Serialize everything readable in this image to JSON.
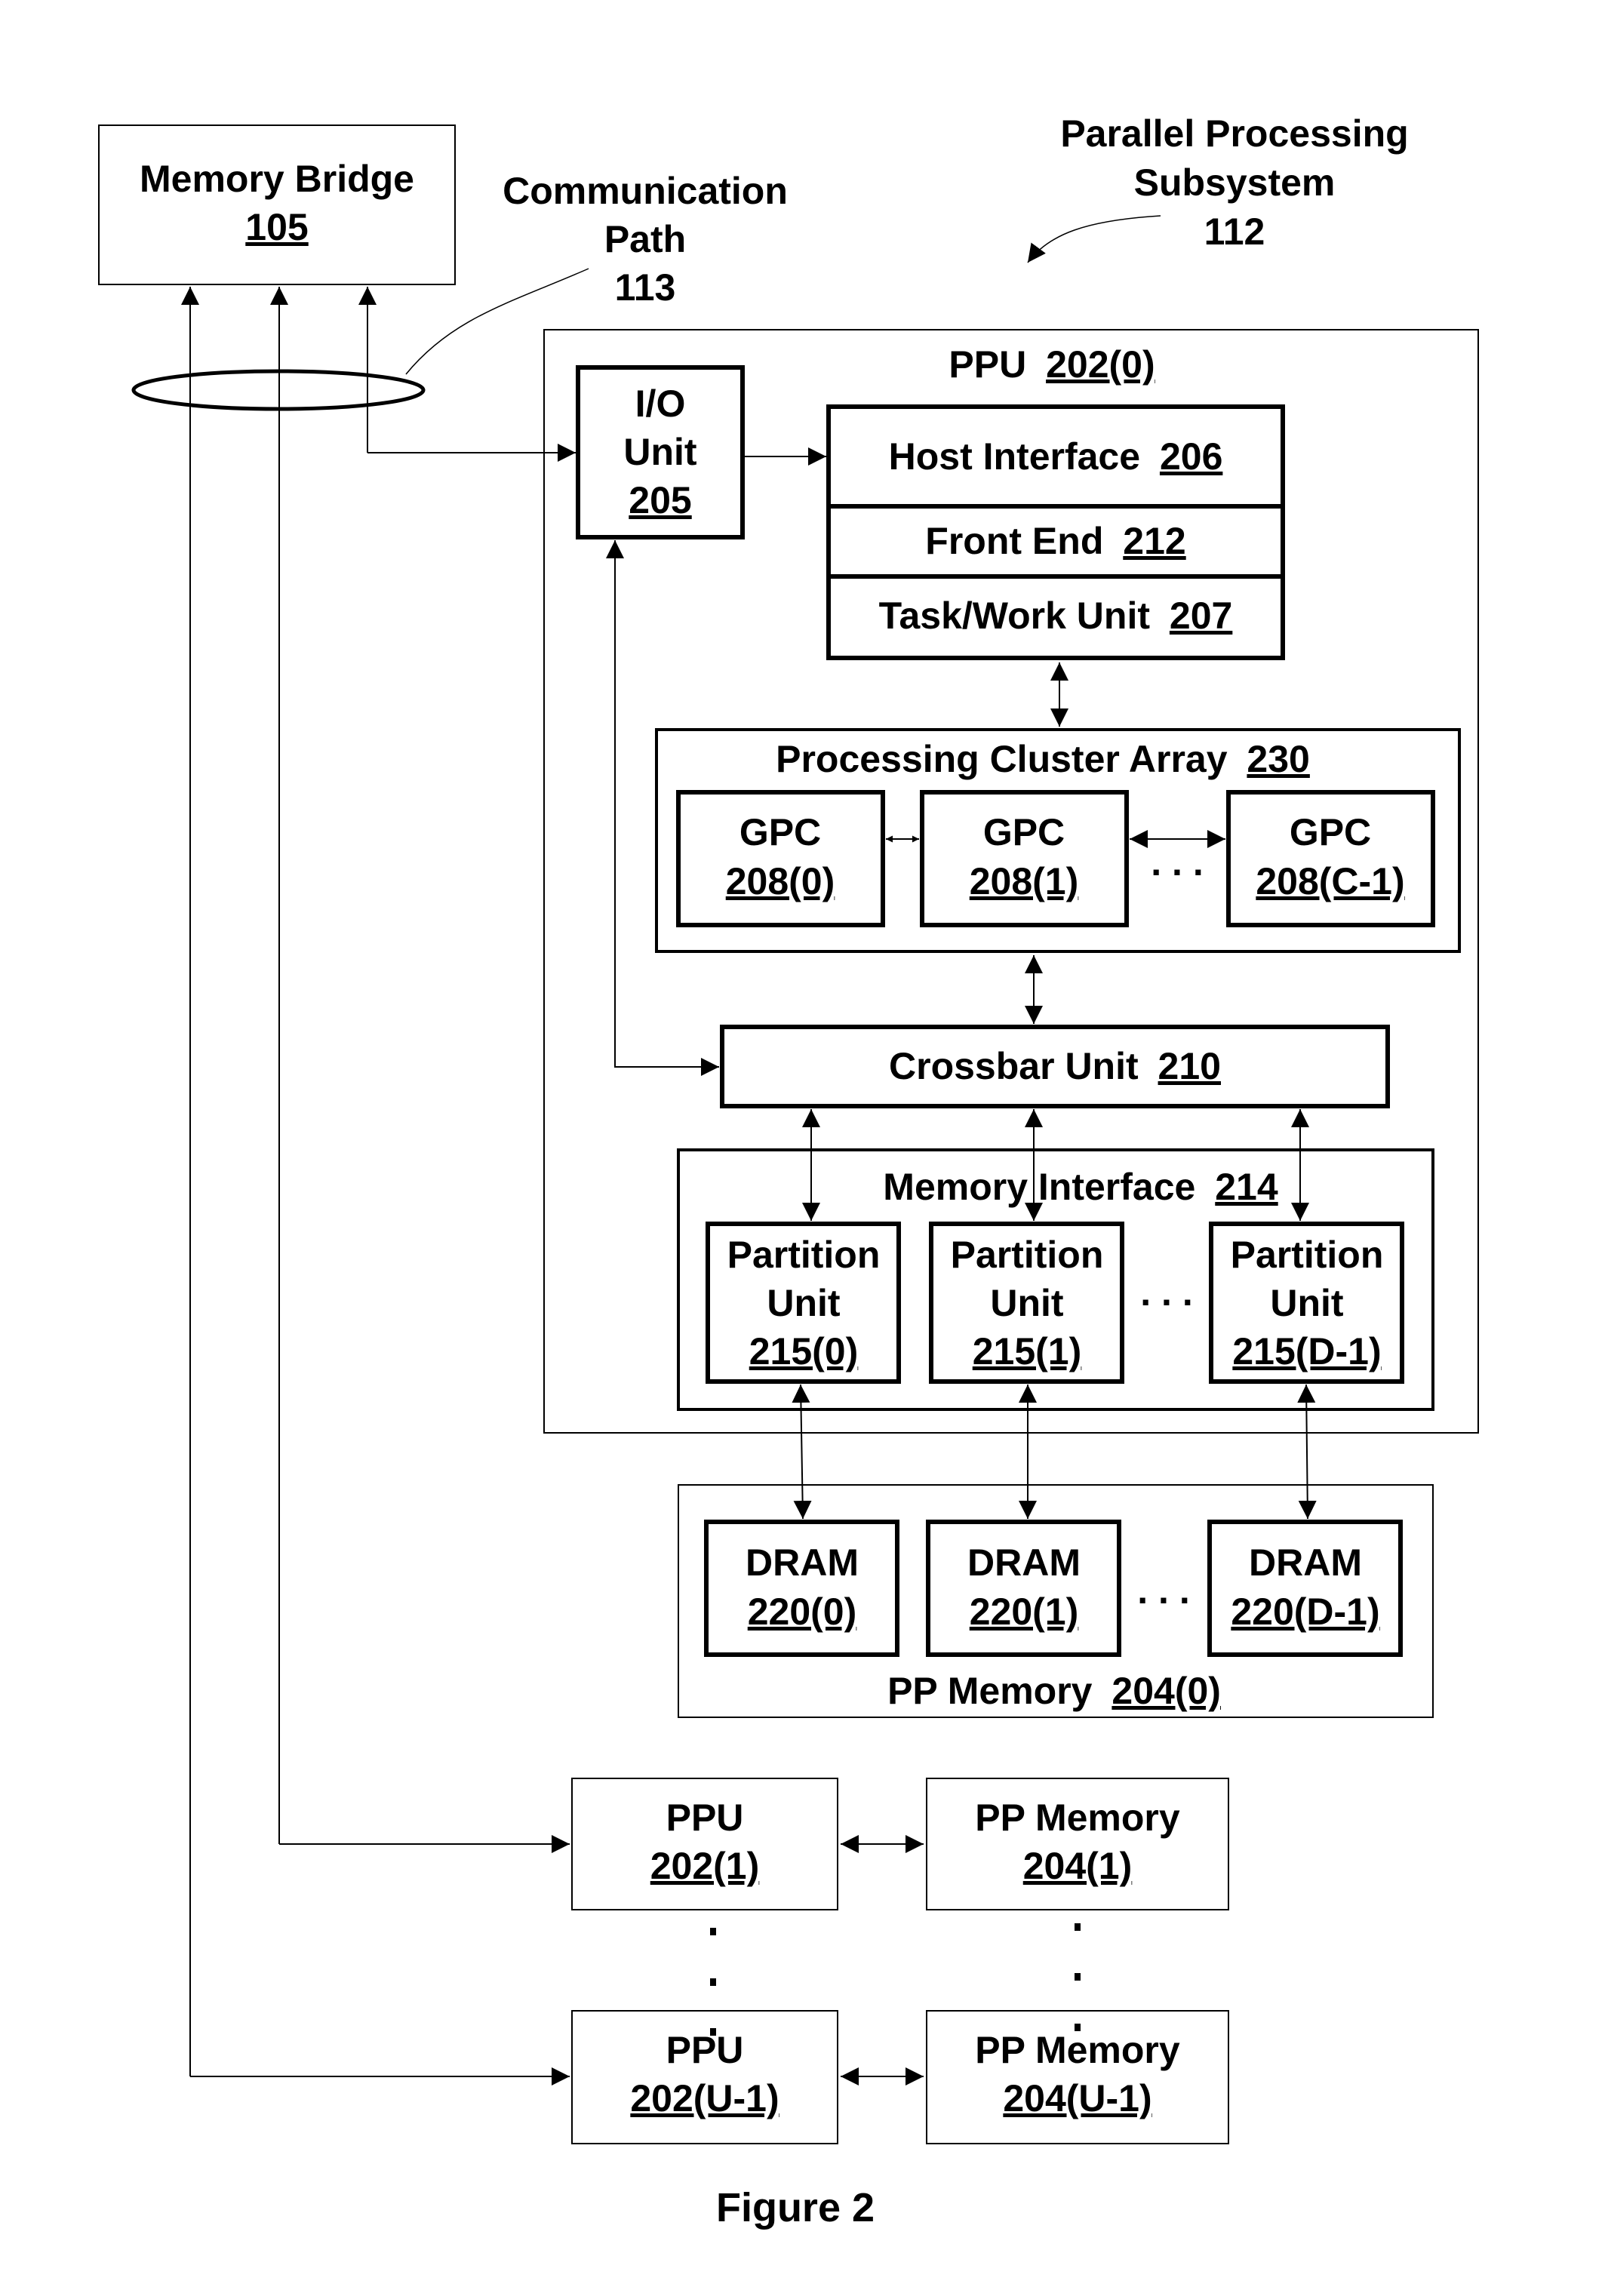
{
  "figure_caption": "Figure 2",
  "colors": {
    "line": "#000000",
    "background": "#ffffff"
  },
  "memory_bridge": {
    "name": "Memory Bridge",
    "ref": "105"
  },
  "communication_path": {
    "line1": "Communication",
    "line2": "Path",
    "ref": "113"
  },
  "subsystem": {
    "line1": "Parallel Processing",
    "line2": "Subsystem",
    "ref": "112"
  },
  "ppu0": {
    "name": "PPU",
    "ref": "202(0)",
    "io_unit": {
      "line1": "I/O",
      "line2": "Unit",
      "ref": "205"
    },
    "host_interface": {
      "name": "Host Interface",
      "ref": "206"
    },
    "front_end": {
      "name": "Front End",
      "ref": "212"
    },
    "task_work_unit": {
      "name": "Task/Work Unit",
      "ref": "207"
    },
    "processing_cluster_array": {
      "name": "Processing Cluster Array",
      "ref": "230",
      "gpcs": [
        {
          "name": "GPC",
          "ref": "208(0)"
        },
        {
          "name": "GPC",
          "ref": "208(1)"
        },
        {
          "name": "GPC",
          "ref": "208(C-1)"
        }
      ],
      "ellipsis": ". . ."
    },
    "crossbar": {
      "name": "Crossbar Unit",
      "ref": "210"
    },
    "memory_interface": {
      "name": "Memory Interface",
      "ref": "214",
      "partitions": [
        {
          "line1": "Partition",
          "line2": "Unit",
          "ref": "215(0)"
        },
        {
          "line1": "Partition",
          "line2": "Unit",
          "ref": "215(1)"
        },
        {
          "line1": "Partition",
          "line2": "Unit",
          "ref": "215(D-1)"
        }
      ],
      "ellipsis": ". . ."
    }
  },
  "pp_memory0": {
    "name": "PP Memory",
    "ref": "204(0)",
    "drams": [
      {
        "name": "DRAM",
        "ref": "220(0)"
      },
      {
        "name": "DRAM",
        "ref": "220(1)"
      },
      {
        "name": "DRAM",
        "ref": "220(D-1)"
      }
    ],
    "ellipsis": ". . ."
  },
  "additional_ppus": [
    {
      "ppu_name": "PPU",
      "ppu_ref": "202(1)",
      "mem_name": "PP Memory",
      "mem_ref": "204(1)"
    },
    {
      "ppu_name": "PPU",
      "ppu_ref": "202(U-1)",
      "mem_name": "PP Memory",
      "mem_ref": "204(U-1)"
    }
  ]
}
